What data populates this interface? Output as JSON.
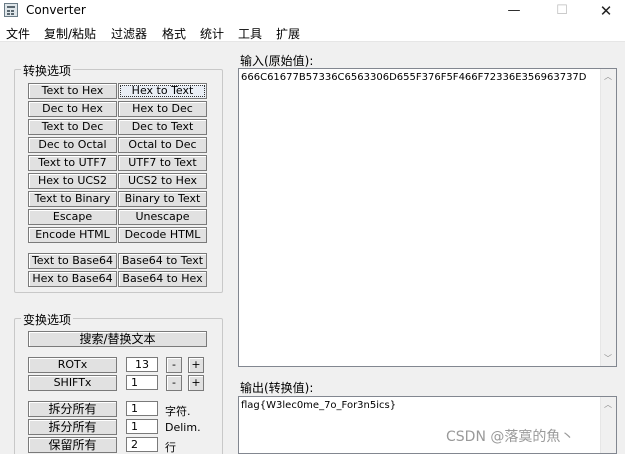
{
  "window": {
    "title": "Converter",
    "controls": {
      "minimize": "—",
      "maximize": "☐",
      "close": "✕"
    }
  },
  "menu": [
    "文件",
    "复制/粘贴",
    "过滤器",
    "格式",
    "统计",
    "工具",
    "扩展"
  ],
  "convert_group": {
    "title": "转换选项",
    "rows": [
      [
        "Text to Hex",
        "Hex to Text"
      ],
      [
        "Dec to Hex",
        "Hex to Dec"
      ],
      [
        "Text to Dec",
        "Dec to Text"
      ],
      [
        "Dec to Octal",
        "Octal to Dec"
      ],
      [
        "Text to UTF7",
        "UTF7 to Text"
      ],
      [
        "Hex to UCS2",
        "UCS2 to Hex"
      ],
      [
        "Text to Binary",
        "Binary to Text"
      ],
      [
        "Escape",
        "Unescape"
      ],
      [
        "Encode HTML",
        "Decode HTML"
      ],
      [
        "Text to Base64",
        "Base64 to Text"
      ],
      [
        "Hex to Base64",
        "Base64 to Hex"
      ]
    ]
  },
  "transform_group": {
    "title": "变换选项",
    "search_replace": "搜索/替换文本",
    "rot": {
      "label": "ROTx",
      "value": "13",
      "minus": "-",
      "plus": "+"
    },
    "shift": {
      "label": "SHIFTx",
      "value": "1",
      "minus": "-",
      "plus": "+"
    },
    "split1": {
      "label": "拆分所有",
      "value": "1",
      "unit": "字符."
    },
    "split2": {
      "label": "拆分所有",
      "value": "1",
      "unit": "Delim."
    },
    "keep": {
      "label": "保留所有",
      "value": "2",
      "unit": "行"
    }
  },
  "input": {
    "label": "输入(原始值):",
    "value": "666C61677B57336C6563306D655F376F5F466F72336E356963737D"
  },
  "output": {
    "label": "输出(转换值):",
    "value": "flag{W3lec0me_7o_For3n5ics}"
  },
  "watermark": "CSDN @落寞的魚丶"
}
